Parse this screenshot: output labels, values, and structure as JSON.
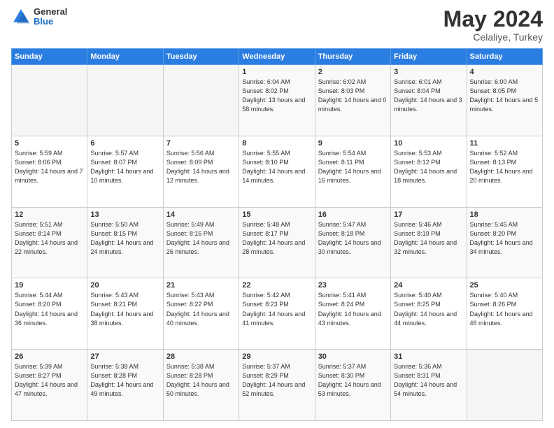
{
  "header": {
    "logo_general": "General",
    "logo_blue": "Blue",
    "month_title": "May 2024",
    "location": "Celaliye, Turkey"
  },
  "weekdays": [
    "Sunday",
    "Monday",
    "Tuesday",
    "Wednesday",
    "Thursday",
    "Friday",
    "Saturday"
  ],
  "weeks": [
    [
      {
        "day": "",
        "sunrise": "",
        "sunset": "",
        "daylight": ""
      },
      {
        "day": "",
        "sunrise": "",
        "sunset": "",
        "daylight": ""
      },
      {
        "day": "",
        "sunrise": "",
        "sunset": "",
        "daylight": ""
      },
      {
        "day": "1",
        "sunrise": "Sunrise: 6:04 AM",
        "sunset": "Sunset: 8:02 PM",
        "daylight": "Daylight: 13 hours and 58 minutes."
      },
      {
        "day": "2",
        "sunrise": "Sunrise: 6:02 AM",
        "sunset": "Sunset: 8:03 PM",
        "daylight": "Daylight: 14 hours and 0 minutes."
      },
      {
        "day": "3",
        "sunrise": "Sunrise: 6:01 AM",
        "sunset": "Sunset: 8:04 PM",
        "daylight": "Daylight: 14 hours and 3 minutes."
      },
      {
        "day": "4",
        "sunrise": "Sunrise: 6:00 AM",
        "sunset": "Sunset: 8:05 PM",
        "daylight": "Daylight: 14 hours and 5 minutes."
      }
    ],
    [
      {
        "day": "5",
        "sunrise": "Sunrise: 5:59 AM",
        "sunset": "Sunset: 8:06 PM",
        "daylight": "Daylight: 14 hours and 7 minutes."
      },
      {
        "day": "6",
        "sunrise": "Sunrise: 5:57 AM",
        "sunset": "Sunset: 8:07 PM",
        "daylight": "Daylight: 14 hours and 10 minutes."
      },
      {
        "day": "7",
        "sunrise": "Sunrise: 5:56 AM",
        "sunset": "Sunset: 8:09 PM",
        "daylight": "Daylight: 14 hours and 12 minutes."
      },
      {
        "day": "8",
        "sunrise": "Sunrise: 5:55 AM",
        "sunset": "Sunset: 8:10 PM",
        "daylight": "Daylight: 14 hours and 14 minutes."
      },
      {
        "day": "9",
        "sunrise": "Sunrise: 5:54 AM",
        "sunset": "Sunset: 8:11 PM",
        "daylight": "Daylight: 14 hours and 16 minutes."
      },
      {
        "day": "10",
        "sunrise": "Sunrise: 5:53 AM",
        "sunset": "Sunset: 8:12 PM",
        "daylight": "Daylight: 14 hours and 18 minutes."
      },
      {
        "day": "11",
        "sunrise": "Sunrise: 5:52 AM",
        "sunset": "Sunset: 8:13 PM",
        "daylight": "Daylight: 14 hours and 20 minutes."
      }
    ],
    [
      {
        "day": "12",
        "sunrise": "Sunrise: 5:51 AM",
        "sunset": "Sunset: 8:14 PM",
        "daylight": "Daylight: 14 hours and 22 minutes."
      },
      {
        "day": "13",
        "sunrise": "Sunrise: 5:50 AM",
        "sunset": "Sunset: 8:15 PM",
        "daylight": "Daylight: 14 hours and 24 minutes."
      },
      {
        "day": "14",
        "sunrise": "Sunrise: 5:49 AM",
        "sunset": "Sunset: 8:16 PM",
        "daylight": "Daylight: 14 hours and 26 minutes."
      },
      {
        "day": "15",
        "sunrise": "Sunrise: 5:48 AM",
        "sunset": "Sunset: 8:17 PM",
        "daylight": "Daylight: 14 hours and 28 minutes."
      },
      {
        "day": "16",
        "sunrise": "Sunrise: 5:47 AM",
        "sunset": "Sunset: 8:18 PM",
        "daylight": "Daylight: 14 hours and 30 minutes."
      },
      {
        "day": "17",
        "sunrise": "Sunrise: 5:46 AM",
        "sunset": "Sunset: 8:19 PM",
        "daylight": "Daylight: 14 hours and 32 minutes."
      },
      {
        "day": "18",
        "sunrise": "Sunrise: 5:45 AM",
        "sunset": "Sunset: 8:20 PM",
        "daylight": "Daylight: 14 hours and 34 minutes."
      }
    ],
    [
      {
        "day": "19",
        "sunrise": "Sunrise: 5:44 AM",
        "sunset": "Sunset: 8:20 PM",
        "daylight": "Daylight: 14 hours and 36 minutes."
      },
      {
        "day": "20",
        "sunrise": "Sunrise: 5:43 AM",
        "sunset": "Sunset: 8:21 PM",
        "daylight": "Daylight: 14 hours and 38 minutes."
      },
      {
        "day": "21",
        "sunrise": "Sunrise: 5:43 AM",
        "sunset": "Sunset: 8:22 PM",
        "daylight": "Daylight: 14 hours and 40 minutes."
      },
      {
        "day": "22",
        "sunrise": "Sunrise: 5:42 AM",
        "sunset": "Sunset: 8:23 PM",
        "daylight": "Daylight: 14 hours and 41 minutes."
      },
      {
        "day": "23",
        "sunrise": "Sunrise: 5:41 AM",
        "sunset": "Sunset: 8:24 PM",
        "daylight": "Daylight: 14 hours and 43 minutes."
      },
      {
        "day": "24",
        "sunrise": "Sunrise: 5:40 AM",
        "sunset": "Sunset: 8:25 PM",
        "daylight": "Daylight: 14 hours and 44 minutes."
      },
      {
        "day": "25",
        "sunrise": "Sunrise: 5:40 AM",
        "sunset": "Sunset: 8:26 PM",
        "daylight": "Daylight: 14 hours and 46 minutes."
      }
    ],
    [
      {
        "day": "26",
        "sunrise": "Sunrise: 5:39 AM",
        "sunset": "Sunset: 8:27 PM",
        "daylight": "Daylight: 14 hours and 47 minutes."
      },
      {
        "day": "27",
        "sunrise": "Sunrise: 5:38 AM",
        "sunset": "Sunset: 8:28 PM",
        "daylight": "Daylight: 14 hours and 49 minutes."
      },
      {
        "day": "28",
        "sunrise": "Sunrise: 5:38 AM",
        "sunset": "Sunset: 8:28 PM",
        "daylight": "Daylight: 14 hours and 50 minutes."
      },
      {
        "day": "29",
        "sunrise": "Sunrise: 5:37 AM",
        "sunset": "Sunset: 8:29 PM",
        "daylight": "Daylight: 14 hours and 52 minutes."
      },
      {
        "day": "30",
        "sunrise": "Sunrise: 5:37 AM",
        "sunset": "Sunset: 8:30 PM",
        "daylight": "Daylight: 14 hours and 53 minutes."
      },
      {
        "day": "31",
        "sunrise": "Sunrise: 5:36 AM",
        "sunset": "Sunset: 8:31 PM",
        "daylight": "Daylight: 14 hours and 54 minutes."
      },
      {
        "day": "",
        "sunrise": "",
        "sunset": "",
        "daylight": ""
      }
    ]
  ]
}
